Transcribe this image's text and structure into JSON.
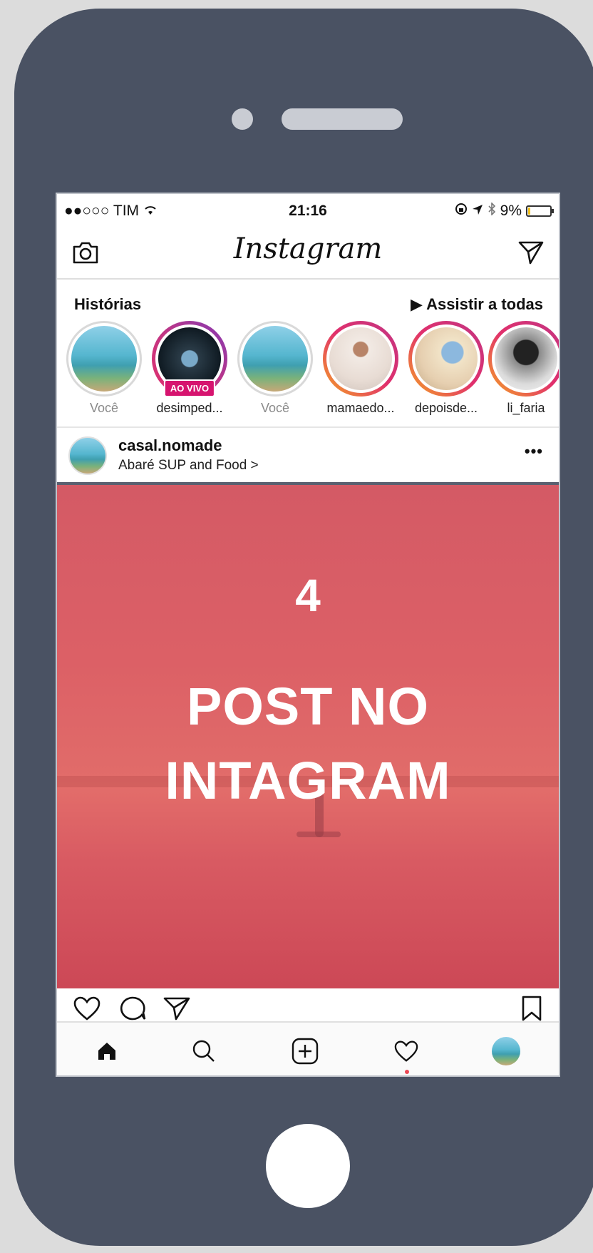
{
  "status_bar": {
    "carrier": "●●○○○ TIM",
    "time": "21:16",
    "battery": "9%",
    "battery_level": 0.09
  },
  "header": {
    "logo": "Instagram"
  },
  "stories": {
    "label": "Histórias",
    "watch_all": "▶ Assistir a todas",
    "items": [
      {
        "name": "Você",
        "avatar": "beach-couple",
        "ring": "none",
        "muted": true
      },
      {
        "name": "desimped...",
        "avatar": "camera-lens",
        "ring": "live",
        "live_label": "AO VIVO"
      },
      {
        "name": "Você",
        "avatar": "beach-couple",
        "ring": "none",
        "muted": true
      },
      {
        "name": "mamaedo...",
        "avatar": "mother-baby",
        "ring": "gradient"
      },
      {
        "name": "depoisde...",
        "avatar": "mother-kid",
        "ring": "gradient"
      },
      {
        "name": "li_faria",
        "avatar": "bw-portrait",
        "ring": "gradient"
      }
    ]
  },
  "post": {
    "username": "casal.nomade",
    "location": "Abaré SUP and Food >",
    "more": "•••",
    "number": "4",
    "title_line1": "POST NO",
    "title_line2": "INTAGRAM"
  },
  "colors": {
    "phone_body": "#4a5263",
    "post_overlay": "#dc6066",
    "live_badge": "#d6146f",
    "notification_dot": "#ed4956"
  }
}
